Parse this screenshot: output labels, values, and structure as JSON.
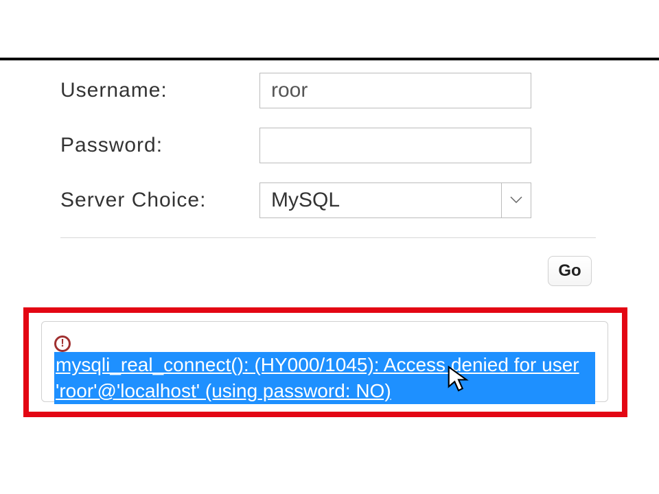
{
  "form": {
    "username_label": "Username:",
    "username_value": "roor",
    "password_label": "Password:",
    "password_value": "",
    "server_label": "Server Choice:",
    "server_selected": "MySQL",
    "go_label": "Go"
  },
  "error": {
    "message": "mysqli_real_connect(): (HY000/1045): Access denied for user 'roor'@'localhost' (using password: NO)"
  }
}
